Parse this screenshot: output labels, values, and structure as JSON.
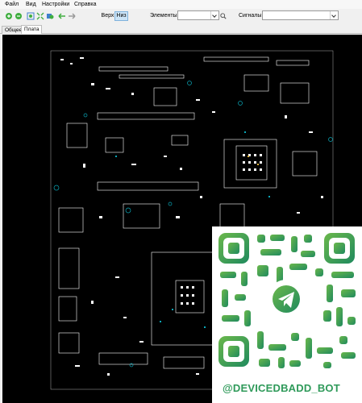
{
  "menu": {
    "file": "Файл",
    "view": "Вид",
    "settings": "Настройки",
    "help": "Справка"
  },
  "toolbar": {
    "top_label": "Верх",
    "bottom_label": "Низ",
    "active_side": "bottom",
    "elements_label": "Элементы:",
    "elements_value": "",
    "signals_label": "Сигналы:",
    "signals_value": ""
  },
  "tabs": [
    {
      "label": "Общее",
      "selected": false
    },
    {
      "label": "Плата",
      "selected": true
    }
  ],
  "board": {
    "background": "#000000",
    "trace_color": "#ffffff",
    "pad_color": "#0aa7b8",
    "pin_accent": "#e0b33a"
  },
  "overlay": {
    "handle": "@DEVICEDBADD_BOT",
    "brand_color": "#2f9a5a",
    "icon": "telegram-icon"
  }
}
